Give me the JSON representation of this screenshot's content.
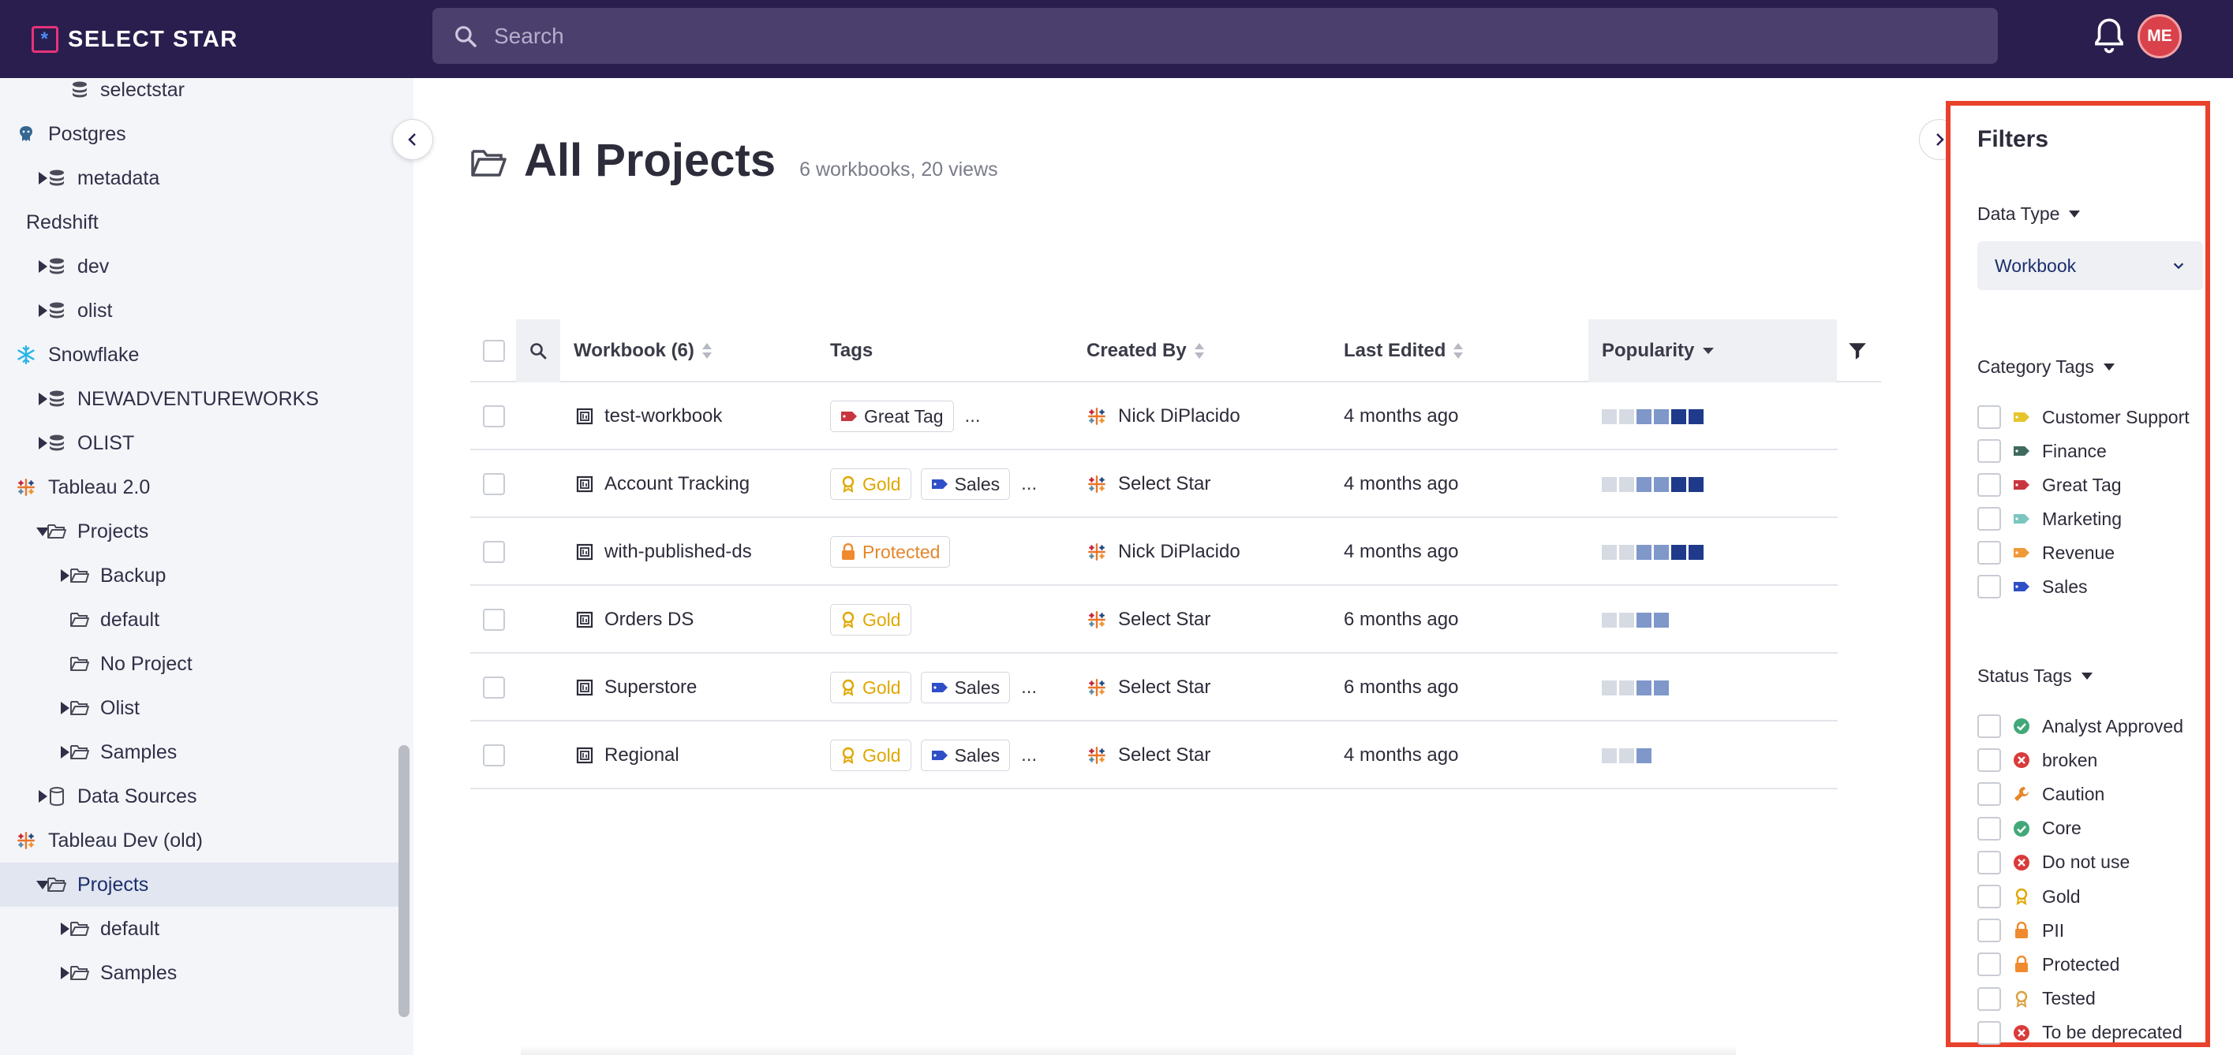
{
  "app": {
    "logo_text": "SELECT STAR",
    "logo_mark": "*"
  },
  "search": {
    "placeholder": "Search"
  },
  "user": {
    "initials": "ME"
  },
  "sidebar": {
    "items": [
      {
        "label": "selectstar",
        "icon": "database-icon",
        "level": 2,
        "caret": "none"
      },
      {
        "label": "Postgres",
        "icon": "postgres-icon",
        "level": 0,
        "caret": "none"
      },
      {
        "label": "metadata",
        "icon": "database-icon",
        "level": 1,
        "caret": "right"
      },
      {
        "label": "Redshift",
        "icon": "redshift-icon",
        "level": 0,
        "caret": "none"
      },
      {
        "label": "dev",
        "icon": "database-icon",
        "level": 1,
        "caret": "right"
      },
      {
        "label": "olist",
        "icon": "database-icon",
        "level": 1,
        "caret": "right"
      },
      {
        "label": "Snowflake",
        "icon": "snowflake-icon",
        "level": 0,
        "caret": "none"
      },
      {
        "label": "NEWADVENTUREWORKS",
        "icon": "database-icon",
        "level": 1,
        "caret": "right"
      },
      {
        "label": "OLIST",
        "icon": "database-icon",
        "level": 1,
        "caret": "right"
      },
      {
        "label": "Tableau 2.0",
        "icon": "tableau-icon",
        "level": 0,
        "caret": "none"
      },
      {
        "label": "Projects",
        "icon": "folder-icon",
        "level": 1,
        "caret": "down"
      },
      {
        "label": "Backup",
        "icon": "folder-icon",
        "level": 2,
        "caret": "right"
      },
      {
        "label": "default",
        "icon": "folder-icon",
        "level": 2,
        "caret": "none"
      },
      {
        "label": "No Project",
        "icon": "folder-icon",
        "level": 2,
        "caret": "none"
      },
      {
        "label": "Olist",
        "icon": "folder-icon",
        "level": 2,
        "caret": "right"
      },
      {
        "label": "Samples",
        "icon": "folder-icon",
        "level": 2,
        "caret": "right"
      },
      {
        "label": "Data Sources",
        "icon": "datasource-icon",
        "level": 1,
        "caret": "right"
      },
      {
        "label": "Tableau Dev (old)",
        "icon": "tableau-icon",
        "level": 0,
        "caret": "none"
      },
      {
        "label": "Projects",
        "icon": "folder-icon",
        "level": 1,
        "caret": "down",
        "active": true
      },
      {
        "label": "default",
        "icon": "folder-icon",
        "level": 2,
        "caret": "right"
      },
      {
        "label": "Samples",
        "icon": "folder-icon",
        "level": 2,
        "caret": "right"
      }
    ]
  },
  "page": {
    "title": "All Projects",
    "subtitle": "6 workbooks, 20 views"
  },
  "table": {
    "headers": {
      "workbook": "Workbook (6)",
      "tags": "Tags",
      "created_by": "Created By",
      "last_edited": "Last Edited",
      "popularity": "Popularity"
    },
    "rows": [
      {
        "name": "test-workbook",
        "tags": [
          {
            "label": "Great Tag",
            "kind": "category",
            "color": "#c9353f"
          }
        ],
        "more": "...",
        "created_by": "Nick DiPlacido",
        "last_edited": "4 months ago",
        "popularity": 6
      },
      {
        "name": "Account Tracking",
        "tags": [
          {
            "label": "Gold",
            "kind": "gold"
          },
          {
            "label": "Sales",
            "kind": "category",
            "color": "#2f4fc8"
          }
        ],
        "more": "...",
        "created_by": "Select Star",
        "last_edited": "4 months ago",
        "popularity": 6
      },
      {
        "name": "with-published-ds",
        "tags": [
          {
            "label": "Protected",
            "kind": "protected"
          }
        ],
        "more": "",
        "created_by": "Nick DiPlacido",
        "last_edited": "4 months ago",
        "popularity": 6
      },
      {
        "name": "Orders DS",
        "tags": [
          {
            "label": "Gold",
            "kind": "gold"
          }
        ],
        "more": "",
        "created_by": "Select Star",
        "last_edited": "6 months ago",
        "popularity": 4
      },
      {
        "name": "Superstore",
        "tags": [
          {
            "label": "Gold",
            "kind": "gold"
          },
          {
            "label": "Sales",
            "kind": "category",
            "color": "#2f4fc8"
          }
        ],
        "more": "...",
        "created_by": "Select Star",
        "last_edited": "6 months ago",
        "popularity": 4
      },
      {
        "name": "Regional",
        "tags": [
          {
            "label": "Gold",
            "kind": "gold"
          },
          {
            "label": "Sales",
            "kind": "category",
            "color": "#2f4fc8"
          }
        ],
        "more": "...",
        "created_by": "Select Star",
        "last_edited": "4 months ago",
        "popularity": 3
      }
    ]
  },
  "filters": {
    "title": "Filters",
    "data_type": {
      "label": "Data Type",
      "value": "Workbook"
    },
    "category_tags": {
      "label": "Category Tags",
      "options": [
        {
          "label": "Customer Support",
          "color": "#e6c52c"
        },
        {
          "label": "Finance",
          "color": "#3f6b5e"
        },
        {
          "label": "Great Tag",
          "color": "#c9353f"
        },
        {
          "label": "Marketing",
          "color": "#7dc6c0"
        },
        {
          "label": "Revenue",
          "color": "#ef9a3a"
        },
        {
          "label": "Sales",
          "color": "#2f4fc8"
        }
      ]
    },
    "status_tags": {
      "label": "Status Tags",
      "options": [
        {
          "label": "Analyst Approved",
          "icon": "check-circle-icon"
        },
        {
          "label": "broken",
          "icon": "x-circle-icon"
        },
        {
          "label": "Caution",
          "icon": "wrench-icon"
        },
        {
          "label": "Core",
          "icon": "check-circle-icon"
        },
        {
          "label": "Do not use",
          "icon": "x-circle-icon"
        },
        {
          "label": "Gold",
          "icon": "gold-award-icon"
        },
        {
          "label": "PII",
          "icon": "lock-icon"
        },
        {
          "label": "Protected",
          "icon": "lock-icon"
        },
        {
          "label": "Tested",
          "icon": "tested-award-icon"
        },
        {
          "label": "To be deprecated",
          "icon": "x-circle-icon"
        }
      ]
    }
  }
}
